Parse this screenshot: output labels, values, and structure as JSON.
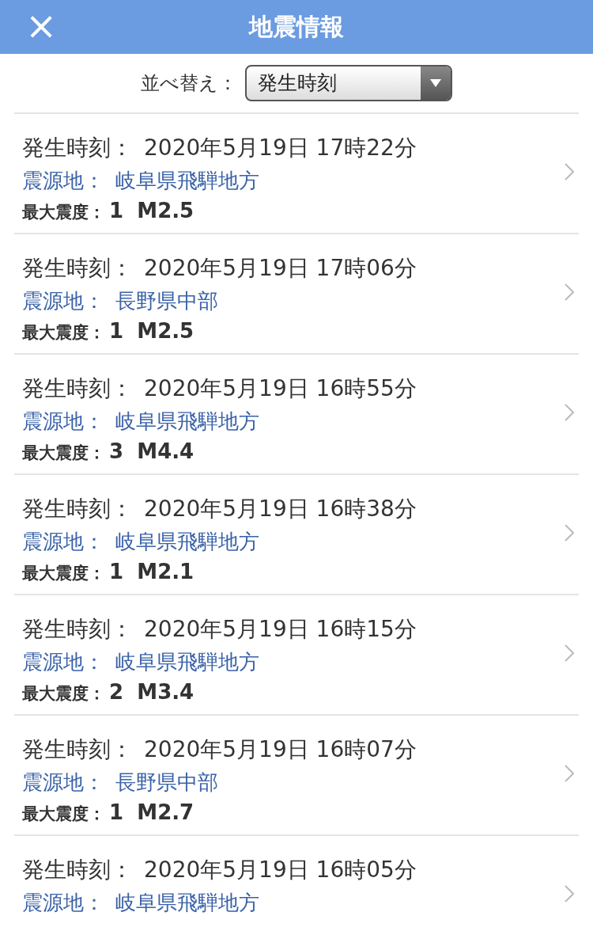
{
  "header": {
    "close": "×",
    "title": "地震情報"
  },
  "sort": {
    "label": "並べ替え：",
    "value": "発生時刻"
  },
  "quakes": [
    {
      "time_label": "発生時刻：",
      "time": "2020年5月19日 17時22分",
      "epicenter_label": "震源地：",
      "epicenter": "岐阜県飛騨地方",
      "intensity_label": "最大震度：",
      "intensity": "1",
      "magnitude": "M2.5"
    },
    {
      "time_label": "発生時刻：",
      "time": "2020年5月19日 17時06分",
      "epicenter_label": "震源地：",
      "epicenter": "長野県中部",
      "intensity_label": "最大震度：",
      "intensity": "1",
      "magnitude": "M2.5"
    },
    {
      "time_label": "発生時刻：",
      "time": "2020年5月19日 16時55分",
      "epicenter_label": "震源地：",
      "epicenter": "岐阜県飛騨地方",
      "intensity_label": "最大震度：",
      "intensity": "3",
      "magnitude": "M4.4"
    },
    {
      "time_label": "発生時刻：",
      "time": "2020年5月19日 16時38分",
      "epicenter_label": "震源地：",
      "epicenter": "岐阜県飛騨地方",
      "intensity_label": "最大震度：",
      "intensity": "1",
      "magnitude": "M2.1"
    },
    {
      "time_label": "発生時刻：",
      "time": "2020年5月19日 16時15分",
      "epicenter_label": "震源地：",
      "epicenter": "岐阜県飛騨地方",
      "intensity_label": "最大震度：",
      "intensity": "2",
      "magnitude": "M3.4"
    },
    {
      "time_label": "発生時刻：",
      "time": "2020年5月19日 16時07分",
      "epicenter_label": "震源地：",
      "epicenter": "長野県中部",
      "intensity_label": "最大震度：",
      "intensity": "1",
      "magnitude": "M2.7"
    },
    {
      "time_label": "発生時刻：",
      "time": "2020年5月19日 16時05分",
      "epicenter_label": "震源地：",
      "epicenter": "岐阜県飛騨地方"
    }
  ]
}
